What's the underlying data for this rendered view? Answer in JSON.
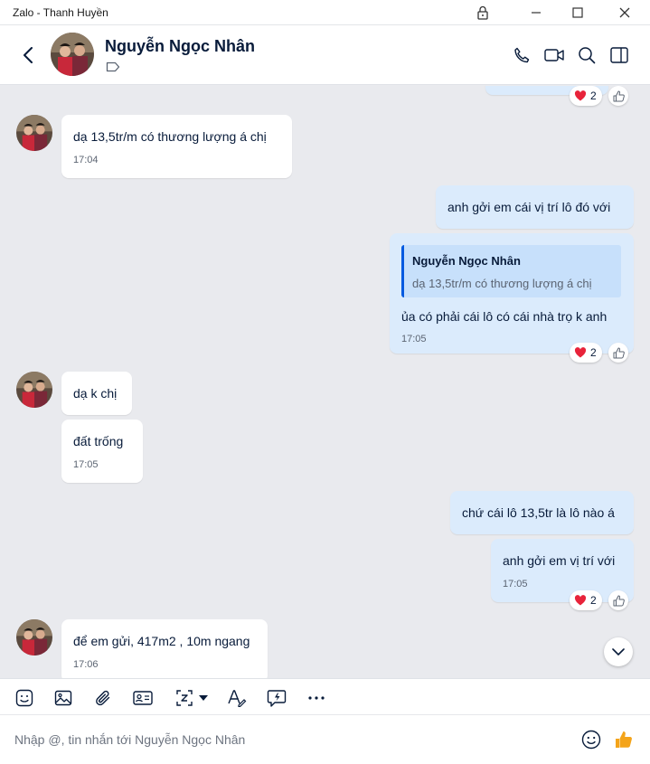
{
  "window": {
    "title": "Zalo - Thanh Huyền"
  },
  "header": {
    "contact_name": "Nguyễn Ngọc Nhân"
  },
  "messages": [
    {
      "text": "dạ 13,5tr/m có thương lượng á chị",
      "time": "17:04"
    },
    {
      "text": "anh gởi em cái vị trí lô đó với"
    },
    {
      "quote": {
        "name": "Nguyễn Ngọc Nhân",
        "text": "dạ 13,5tr/m có thương lượng á chị"
      },
      "text": "ủa có phải cái lô có cái nhà trọ k anh",
      "time": "17:05"
    },
    {
      "text": "dạ k chị"
    },
    {
      "text": "đất trống",
      "time": "17:05"
    },
    {
      "text": "chứ cái lô 13,5tr là lô nào á"
    },
    {
      "text": "anh gởi em vị trí với",
      "time": "17:05"
    },
    {
      "text": "để em gửi, 417m2 , 10m ngang",
      "time": "17:06"
    }
  ],
  "reactions": [
    {
      "emoji": "heart",
      "count": "2"
    },
    {
      "emoji": "heart",
      "count": "2"
    },
    {
      "emoji": "heart",
      "count": "2"
    }
  ],
  "composer": {
    "placeholder": "Nhập @, tin nhắn tới Nguyễn Ngọc Nhân"
  },
  "colors": {
    "accent": "#005ae0",
    "outgoing_bubble": "#dbebfc",
    "incoming_bubble": "#ffffff",
    "chat_background": "#e9eaee",
    "heart": "#e8233a",
    "like": "#f4a41a"
  }
}
